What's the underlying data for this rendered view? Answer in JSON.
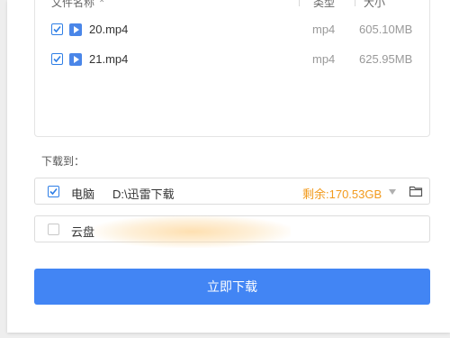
{
  "file_list": {
    "header": {
      "name": "文件名称",
      "type": "类型",
      "size": "大小"
    },
    "files": [
      {
        "checked": true,
        "name": "20.mp4",
        "type": "mp4",
        "size": "605.10MB"
      },
      {
        "checked": true,
        "name": "21.mp4",
        "type": "mp4",
        "size": "625.95MB"
      }
    ]
  },
  "download_to_label": "下载到：",
  "destinations": {
    "pc": {
      "checked": true,
      "name": "电脑",
      "path": "D:\\迅雷下载",
      "free_space": "剩余:170.53GB"
    },
    "cloud": {
      "checked": false,
      "name": "云盘"
    }
  },
  "download_button": "立即下载",
  "colors": {
    "accent": "#4285f4",
    "checkbox": "#2f7fe6",
    "free_space": "#f29a1c"
  }
}
